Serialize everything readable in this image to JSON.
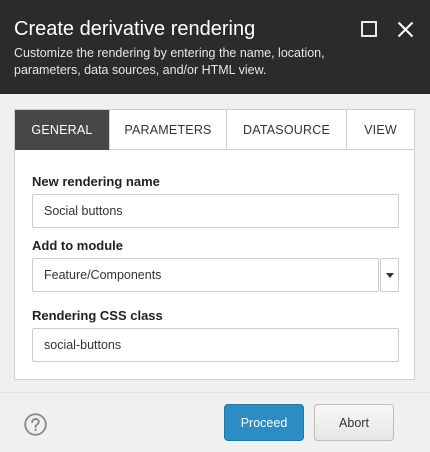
{
  "dialog": {
    "title": "Create derivative rendering",
    "subtitle": "Customize the rendering by entering the name, location, parameters, data sources, and/or HTML view."
  },
  "window_controls": {
    "maximize_icon": "maximize-icon",
    "close_icon": "close-icon"
  },
  "tabs": [
    {
      "label": "GENERAL",
      "active": true
    },
    {
      "label": "PARAMETERS",
      "active": false
    },
    {
      "label": "DATASOURCE",
      "active": false
    },
    {
      "label": "VIEW",
      "active": false
    }
  ],
  "form": {
    "rendering_name": {
      "label": "New rendering name",
      "value": "Social buttons"
    },
    "module": {
      "label": "Add to module",
      "selected": "Feature/Components"
    },
    "css_class": {
      "label": "Rendering CSS class",
      "value": "social-buttons"
    }
  },
  "footer": {
    "help_icon": "help-icon",
    "proceed_label": "Proceed",
    "abort_label": "Abort"
  },
  "colors": {
    "header_bg": "#2b2b2b",
    "active_tab_bg": "#474747",
    "primary_button": "#2b8dc4",
    "content_bg": "#f0f0f0"
  }
}
